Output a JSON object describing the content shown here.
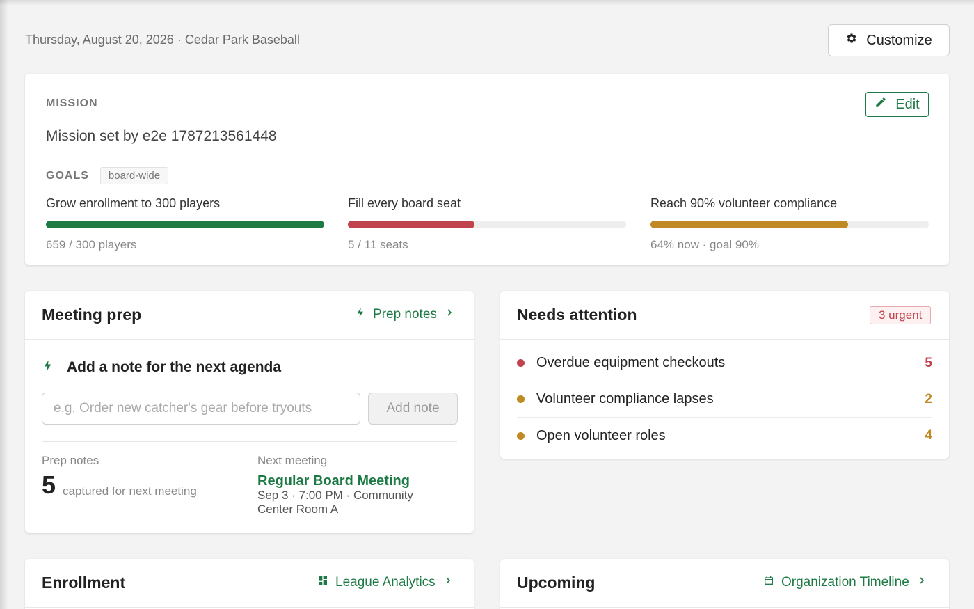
{
  "header": {
    "date": "Thursday, August 20, 2026",
    "org": "Cedar Park Baseball",
    "customize_label": "Customize"
  },
  "mission": {
    "label": "MISSION",
    "text": "Mission set by e2e 1787213561448",
    "edit_label": "Edit",
    "goals_label": "GOALS",
    "goals_tag": "board-wide",
    "goals": [
      {
        "title": "Grow enrollment to 300 players",
        "progress": 1.0,
        "color": "#1e7a45",
        "subtitle": "659 / 300 players"
      },
      {
        "title": "Fill every board seat",
        "progress": 0.4545,
        "color": "#c0434d",
        "subtitle": "5 / 11 seats"
      },
      {
        "title": "Reach 90% volunteer compliance",
        "progress": 0.711,
        "color": "#bf8a23",
        "subtitle": "64% now · goal 90%"
      }
    ]
  },
  "meeting_prep": {
    "title": "Meeting prep",
    "link_label": "Prep notes",
    "subhead": "Add a note for the next agenda",
    "input_placeholder": "e.g. Order new catcher's gear before tryouts",
    "input_value": "",
    "add_button_label": "Add note",
    "prep_notes_label": "Prep notes",
    "prep_notes_count": "5",
    "prep_notes_caption": "captured for next meeting",
    "next_meeting_label": "Next meeting",
    "next_meeting_name": "Regular Board Meeting",
    "next_meeting_detail": "Sep 3 · 7:00 PM · Community Center Room A"
  },
  "needs_attention": {
    "title": "Needs attention",
    "badge": "3 urgent",
    "items": [
      {
        "label": "Overdue equipment checkouts",
        "count": "5",
        "color": "#c0434d"
      },
      {
        "label": "Volunteer compliance lapses",
        "count": "2",
        "color": "#bf8a23"
      },
      {
        "label": "Open volunteer roles",
        "count": "4",
        "color": "#bf8a23"
      }
    ]
  },
  "enrollment": {
    "title": "Enrollment",
    "link_label": "League Analytics"
  },
  "upcoming": {
    "title": "Upcoming",
    "link_label": "Organization Timeline"
  },
  "colors": {
    "accent": "#1e7a45",
    "danger": "#c0434d",
    "warning": "#bf8a23"
  }
}
